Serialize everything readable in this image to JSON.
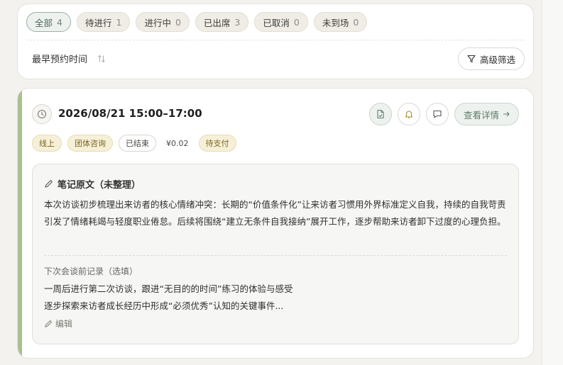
{
  "filters": {
    "tabs": [
      {
        "label": "全部",
        "count": "4"
      },
      {
        "label": "待进行",
        "count": "1"
      },
      {
        "label": "进行中",
        "count": "0"
      },
      {
        "label": "已出席",
        "count": "3"
      },
      {
        "label": "已取消",
        "count": "0"
      },
      {
        "label": "未到场",
        "count": "0"
      }
    ],
    "sort_label": "最早预约时间",
    "advanced_filter_label": "高级筛选"
  },
  "appointment": {
    "datetime": "2026/08/21 15:00–17:00",
    "detail_label": "查看详情",
    "tags": {
      "mode": "线上",
      "type": "团体咨询",
      "status": "已结束",
      "price": "¥0.02",
      "payment": "待支付"
    },
    "notes": {
      "title": "笔记原文（未整理）",
      "body": "本次访谈初步梳理出来访者的核心情绪冲突：长期的“价值条件化”让来访者习惯用外界标准定义自我，持续的自我苛责引发了情绪耗竭与轻度职业倦怠。后续将围绕“建立无条件自我接纳”展开工作，逐步帮助来访者卸下过度的心理负担。",
      "next_label": "下次会谈前记录（选填）",
      "next_line_1": "一周后进行第二次访谈，跟进“无目的的时间”练习的体验与感受",
      "next_line_2": "逐步探索来访者成长经历中形成“必须优秀”认知的关键事件...",
      "edit_label": "编辑"
    }
  },
  "colors": {
    "accent_bar": "#a9c08e",
    "active_tab": "#4c6b5c",
    "tag_yellow": "#f6f0d8"
  }
}
